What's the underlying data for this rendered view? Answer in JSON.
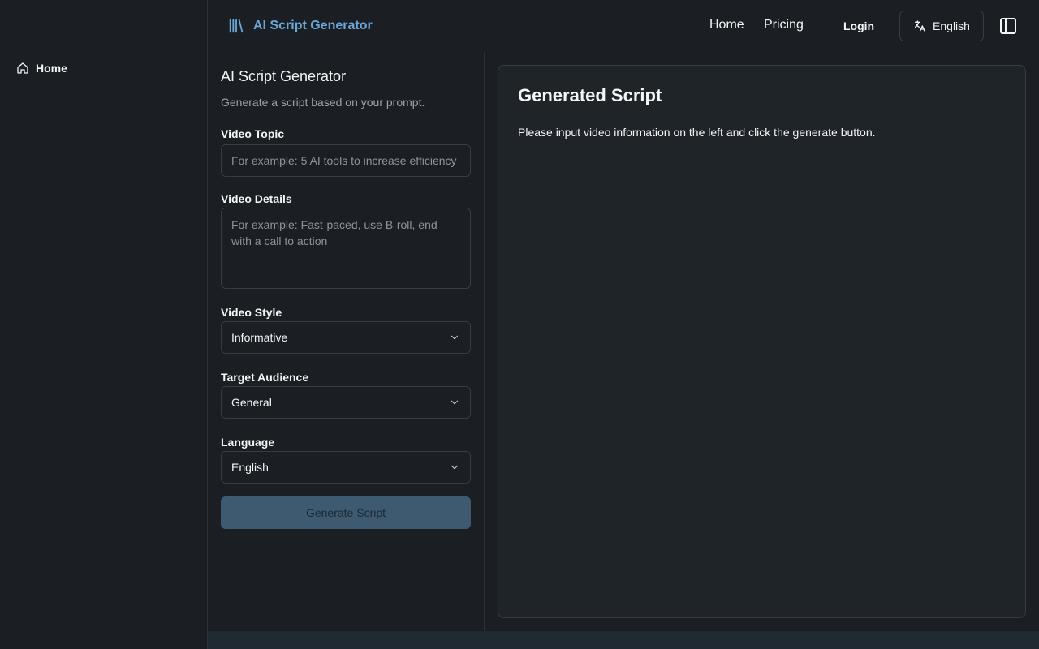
{
  "sidebar": {
    "items": [
      {
        "label": "Home",
        "icon": "home-icon"
      }
    ]
  },
  "header": {
    "brand": "AI Script Generator",
    "brand_icon": "library-icon",
    "nav": {
      "home": "Home",
      "pricing": "Pricing"
    },
    "login": "Login",
    "language_button": "English",
    "language_icon": "translate-icon",
    "panel_toggle_icon": "panel-left-icon",
    "accent_color": "#6aa6d6"
  },
  "form": {
    "title": "AI Script Generator",
    "subtitle": "Generate a script based on your prompt.",
    "video_topic": {
      "label": "Video Topic",
      "placeholder": "For example: 5 AI tools to increase efficiency",
      "value": ""
    },
    "video_details": {
      "label": "Video Details",
      "placeholder": "For example: Fast-paced, use B-roll, end with a call to action",
      "value": ""
    },
    "video_style": {
      "label": "Video Style",
      "value": "Informative"
    },
    "target_audience": {
      "label": "Target Audience",
      "value": "General"
    },
    "language": {
      "label": "Language",
      "value": "English"
    },
    "generate_button": "Generate Script"
  },
  "output": {
    "title": "Generated Script",
    "message": "Please input video information on the left and click the generate button."
  }
}
